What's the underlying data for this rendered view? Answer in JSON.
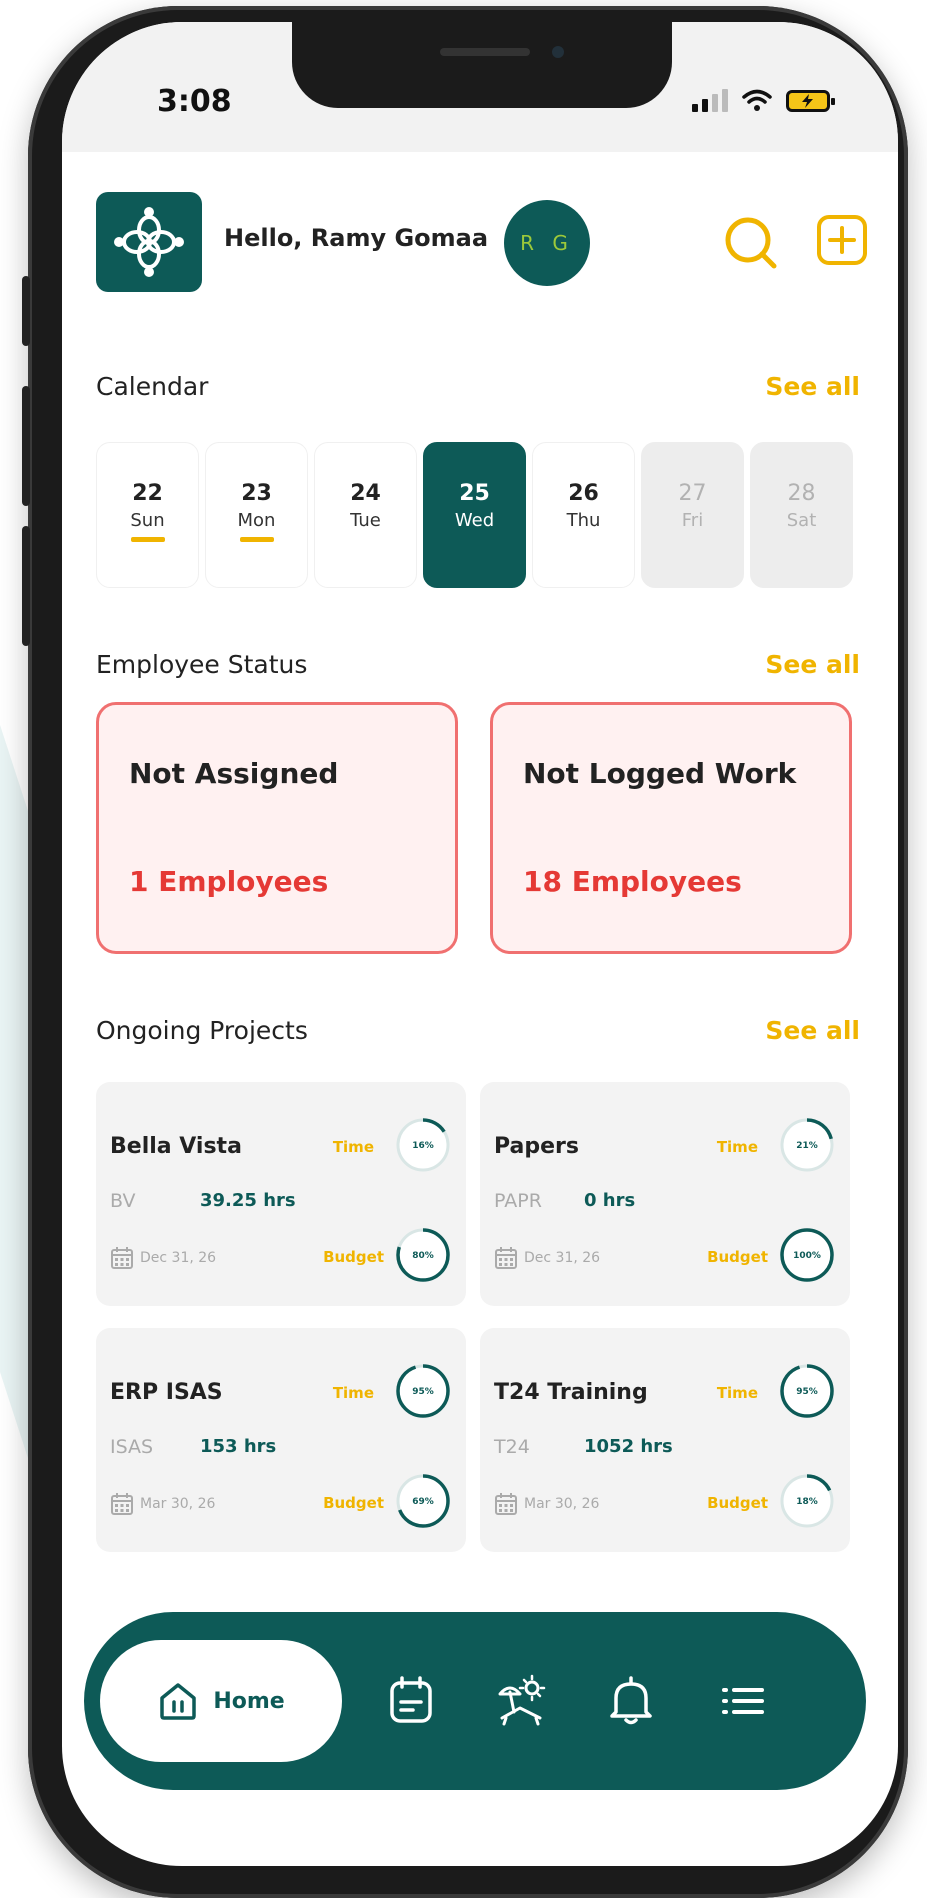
{
  "status_bar": {
    "time": "3:08"
  },
  "header": {
    "greeting": "Hello, Ramy Gomaa",
    "avatar_initials": "R G"
  },
  "calendar": {
    "title": "Calendar",
    "see_all": "See all",
    "days": [
      {
        "num": "22",
        "name": "Sun",
        "state": "marked"
      },
      {
        "num": "23",
        "name": "Mon",
        "state": "marked"
      },
      {
        "num": "24",
        "name": "Tue",
        "state": "normal"
      },
      {
        "num": "25",
        "name": "Wed",
        "state": "active"
      },
      {
        "num": "26",
        "name": "Thu",
        "state": "normal"
      },
      {
        "num": "27",
        "name": "Fri",
        "state": "off"
      },
      {
        "num": "28",
        "name": "Sat",
        "state": "off"
      }
    ]
  },
  "employee_status": {
    "title": "Employee Status",
    "see_all": "See all",
    "cards": [
      {
        "title": "Not Assigned",
        "count": "1 Employees"
      },
      {
        "title": "Not Logged Work",
        "count": "18 Employees"
      }
    ]
  },
  "projects": {
    "title": "Ongoing Projects",
    "see_all": "See all",
    "time_label": "Time",
    "budget_label": "Budget",
    "items": [
      {
        "name": "Bella Vista",
        "code": "BV",
        "hours": "39.25 hrs",
        "date": "Dec 31, 26",
        "time_pct": 16,
        "budget_pct": 80
      },
      {
        "name": "Papers",
        "code": "PAPR",
        "hours": "0 hrs",
        "date": "Dec 31, 26",
        "time_pct": 21,
        "budget_pct": 100
      },
      {
        "name": "ERP ISAS",
        "code": "ISAS",
        "hours": "153 hrs",
        "date": "Mar 30, 26",
        "time_pct": 95,
        "budget_pct": 69
      },
      {
        "name": "T24 Training",
        "code": "T24",
        "hours": "1052 hrs",
        "date": "Mar 30, 26",
        "time_pct": 95,
        "budget_pct": 18
      }
    ]
  },
  "bottom_nav": {
    "home_label": "Home",
    "icons": [
      "home-icon",
      "calendar-icon",
      "vacation-icon",
      "bell-icon",
      "menu-icon"
    ]
  },
  "colors": {
    "primary": "#0d5a57",
    "accent": "#f0b400",
    "alert": "#e53935",
    "alert_bg": "#fff1f1"
  }
}
